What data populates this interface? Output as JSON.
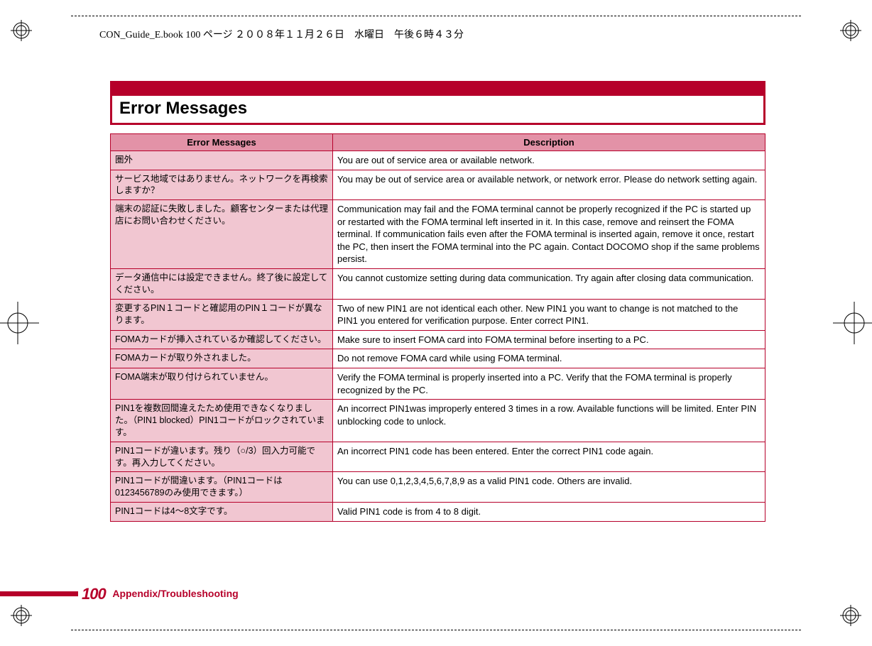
{
  "page_info": "CON_Guide_E.book  100 ページ  ２００８年１１月２６日　水曜日　午後６時４３分",
  "title": "Error Messages",
  "table": {
    "headers": [
      "Error Messages",
      "Description"
    ],
    "rows": [
      {
        "msg": "圏外",
        "desc": "You are out of service area or available network."
      },
      {
        "msg": "サービス地域ではありません。ネットワークを再検索しますか？",
        "desc": "You may be out of service area or available network, or network error. Please do network setting again."
      },
      {
        "msg": "端末の認証に失敗しました。顧客センターまたは代理店にお問い合わせください。",
        "desc": "Communication may fail and the FOMA terminal cannot be properly recognized if the PC is started up or restarted with the FOMA terminal left inserted in it. In this case, remove and reinsert the FOMA terminal. If communication fails even after the FOMA terminal is inserted again, remove it once, restart the PC, then insert the FOMA terminal into the PC again. Contact DOCOMO shop if the same problems persist."
      },
      {
        "msg": "データ通信中には設定できません。終了後に設定してください。",
        "desc": "You cannot customize setting during data communication. Try again after closing data communication."
      },
      {
        "msg": "変更するPIN１コードと確認用のPIN１コードが異なります。",
        "desc": "Two of new PIN1 are not identical each other. New PIN1 you want to change is not matched to the PIN1 you entered for verification purpose. Enter correct PIN1."
      },
      {
        "msg": "FOMAカードが挿入されているか確認してください。",
        "desc": "Make sure to insert FOMA card into FOMA terminal before inserting to a PC."
      },
      {
        "msg": "FOMAカードが取り外されました。",
        "desc": "Do not remove FOMA card while using FOMA terminal."
      },
      {
        "msg": "FOMA端末が取り付けられていません。",
        "desc": "Verify the FOMA terminal is properly inserted into a PC. Verify that the FOMA terminal is properly recognized by the PC."
      },
      {
        "msg": "PIN1を複数回間違えたため使用できなくなりました。（PIN1 blocked）PIN1コードがロックされています。",
        "desc": "An incorrect PIN1was improperly entered 3 times in a row. Available functions will be limited. Enter PIN unblocking code to unlock."
      },
      {
        "msg": "PIN1コードが違います。残り（○/3）回入力可能です。再入力してください。",
        "desc": "An incorrect PIN1 code has been entered. Enter the correct PIN1 code again."
      },
      {
        "msg": "PIN1コードが間違います。（PIN1コードは0123456789のみ使用できます。）",
        "desc": "You can use 0,1,2,3,4,5,6,7,8,9 as a valid PIN1 code. Others are invalid."
      },
      {
        "msg": "PIN1コードは4～8文字です。",
        "desc": "Valid PIN1 code is from 4 to 8 digit."
      }
    ]
  },
  "footer": {
    "page_number": "100",
    "section": "Appendix/Troubleshooting"
  }
}
